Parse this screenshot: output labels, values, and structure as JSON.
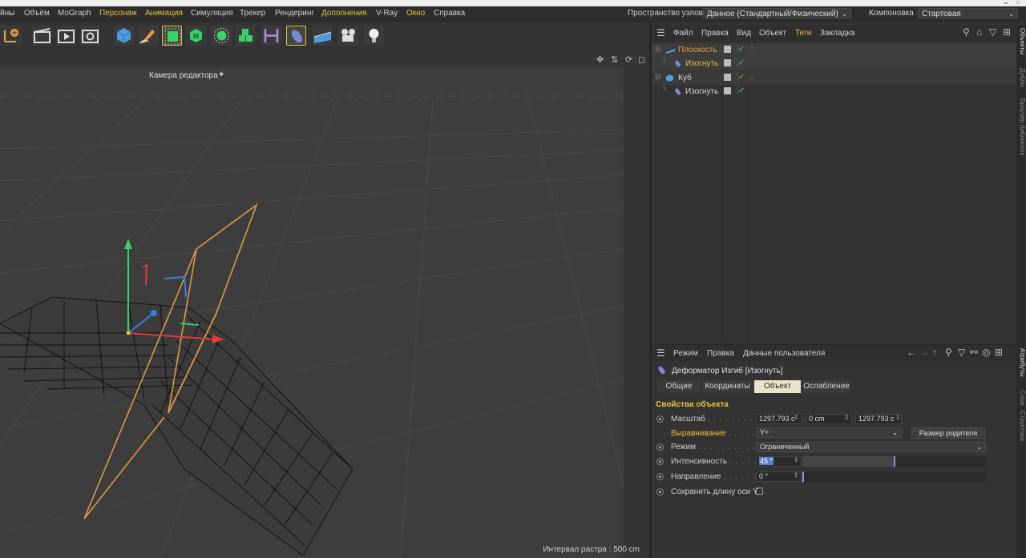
{
  "menubar": {
    "items": [
      {
        "label": "йны",
        "accent": false
      },
      {
        "label": "Объём",
        "accent": false
      },
      {
        "label": "MoGraph",
        "accent": false
      },
      {
        "label": "Персонаж",
        "accent": true
      },
      {
        "label": "Анимация",
        "accent": true
      },
      {
        "label": "Симуляция",
        "accent": false
      },
      {
        "label": "Трекер",
        "accent": false
      },
      {
        "label": "Рендеринг",
        "accent": false
      },
      {
        "label": "Дополнения",
        "accent": true
      },
      {
        "label": "V-Ray",
        "accent": false
      },
      {
        "label": "Окно",
        "accent": true
      },
      {
        "label": "Справка",
        "accent": false
      }
    ],
    "node_space_label": "Пространство узлов:",
    "node_space_value": "Данное (Стандартный/Физический)",
    "layout_label": "Компоновка",
    "layout_value": "Стартовая"
  },
  "viewport": {
    "camera_label": "Камера редактора",
    "raster_label": "Интервал растра : 500 cm"
  },
  "object_manager": {
    "menu": [
      {
        "label": "Файл",
        "accent": false
      },
      {
        "label": "Правка",
        "accent": false
      },
      {
        "label": "Вид",
        "accent": false
      },
      {
        "label": "Объект",
        "accent": false
      },
      {
        "label": "Теги",
        "accent": true
      },
      {
        "label": "Закладка",
        "accent": false
      }
    ],
    "rows": [
      {
        "name": "Плоскость",
        "color": "#e8a040",
        "indent": 0,
        "icon": "plane-icon"
      },
      {
        "name": "Изогнуть",
        "color": "#e8c03a",
        "indent": 1,
        "icon": "bend-icon"
      },
      {
        "name": "Куб",
        "color": "#d8d8d8",
        "indent": 0,
        "icon": "cube-icon"
      },
      {
        "name": "Изогнуть",
        "color": "#d8d8d8",
        "indent": 1,
        "icon": "bend-icon"
      }
    ]
  },
  "right_tabs": [
    "Объекты",
    "Дубли",
    "Браузер библиотек",
    "Атрибуты",
    "Слои",
    "Структура"
  ],
  "attributes": {
    "menu": [
      "Режим",
      "Правка",
      "Данные пользователя"
    ],
    "title": "Деформатор Изгиб [Изогнуть]",
    "tabs": [
      {
        "label": "Общие",
        "active": false
      },
      {
        "label": "Координаты",
        "active": false
      },
      {
        "label": "Объект",
        "active": true
      },
      {
        "label": "Ослабление",
        "active": false
      }
    ],
    "section_title": "Свойства объекта",
    "props": {
      "scale": {
        "label": "Масштаб",
        "dots": ". . . . . . . . .",
        "x": "1297.793 c",
        "y": "0 cm",
        "z": "1297.793 c"
      },
      "align": {
        "label": "Выравнивание",
        "dots": ". . . . .",
        "value": "Y+",
        "button": "Размер родителя"
      },
      "mode": {
        "label": "Режим",
        "dots": ". . . . . . . . . . .",
        "value": "Ограниченный"
      },
      "strength": {
        "label": "Интенсивность",
        "dots": ". . . . .",
        "value": "45 °",
        "fill": 0.5
      },
      "direction": {
        "label": "Направление",
        "dots": ". . . . . .",
        "value": "0 °",
        "fill": 0.0
      },
      "keep_length": {
        "label": "Сохранить длину оси Y"
      }
    }
  },
  "colors": {
    "accent": "#e8c03a",
    "active_tab": "#e9e4c9",
    "axis_x": "#e03a3a",
    "axis_y": "#3ad06a",
    "axis_z": "#3a80e0",
    "deformer_box": "#e8a040"
  }
}
